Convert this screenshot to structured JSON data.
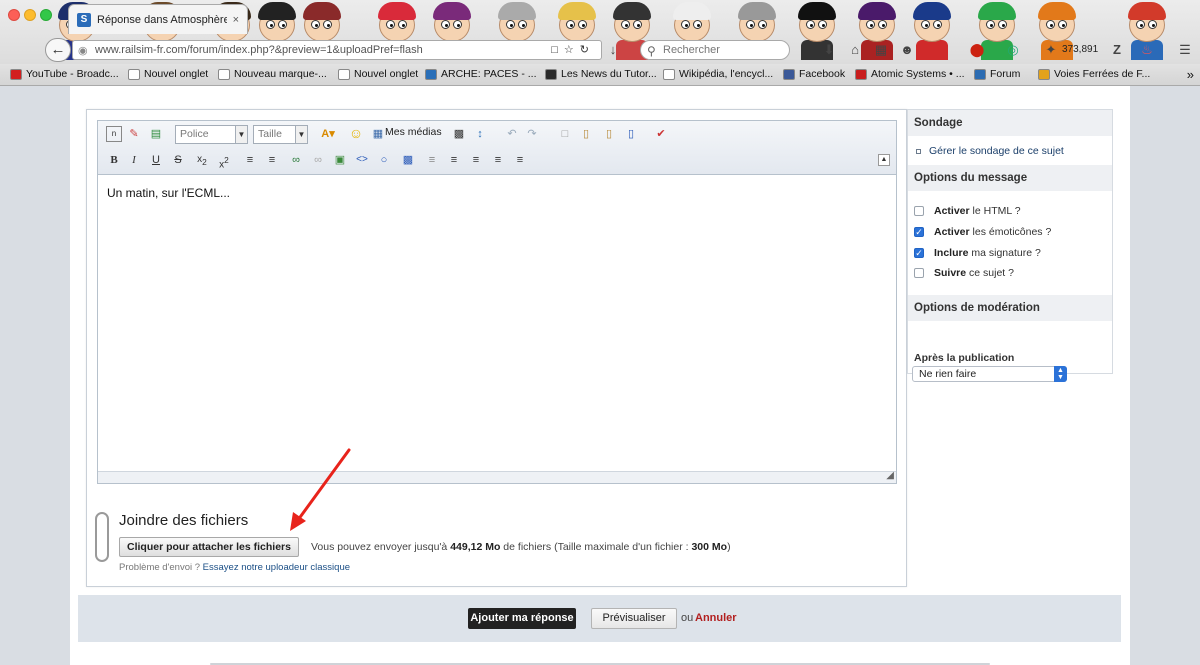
{
  "browser": {
    "tab_title": "Réponse dans Atmosphère...",
    "tab_close": "×",
    "url": "www.railsim-fr.com/forum/index.php?&preview=1&uploadPref=flash",
    "search_placeholder": "Rechercher",
    "counter": "373,891",
    "bookmarks": [
      {
        "label": "YouTube - Broadc...",
        "color": "#d21f1f"
      },
      {
        "label": "Nouvel onglet",
        "color": "#ffffff"
      },
      {
        "label": "Nouveau marque-...",
        "color": "#ffffff"
      },
      {
        "label": "Nouvel onglet",
        "color": "#ffffff"
      },
      {
        "label": "ARCHE: PACES - ...",
        "color": "#2a6fb8"
      },
      {
        "label": "Les News du Tutor...",
        "color": "#2a2a2a"
      },
      {
        "label": "Wikipédia, l'encycl...",
        "color": "#ffffff"
      },
      {
        "label": "Facebook",
        "color": "#3b5998"
      },
      {
        "label": "Atomic Systems • ...",
        "color": "#c81d1d"
      },
      {
        "label": "Forum",
        "color": "#2c6cb2"
      },
      {
        "label": "Voies Ferrées de F...",
        "color": "#e2a21b"
      }
    ]
  },
  "editor": {
    "font_select": "Police",
    "size_select": "Taille",
    "medias_label": "Mes médias",
    "content": "Un matin, sur l'ECML..."
  },
  "attach": {
    "title": "Joindre des fichiers",
    "button": "Cliquer pour attacher les fichiers",
    "info_prefix": "Vous pouvez envoyer jusqu'à ",
    "info_amount": "449,12 Mo",
    "info_mid": " de fichiers (Taille maximale d'un fichier : ",
    "info_max": "300 Mo",
    "info_suffix": ")",
    "problem_text": "Problème d'envoi ? ",
    "problem_link": "Essayez notre uploadeur classique"
  },
  "sidebar": {
    "poll_header": "Sondage",
    "poll_link": "Gérer le sondage de ce sujet",
    "options_header": "Options du message",
    "options": [
      {
        "bold": "Activer",
        "rest": " le HTML ?",
        "checked": false
      },
      {
        "bold": "Activer",
        "rest": " les émoticônes ?",
        "checked": true
      },
      {
        "bold": "Inclure",
        "rest": " ma signature ?",
        "checked": true
      },
      {
        "bold": "Suivre",
        "rest": " ce sujet ?",
        "checked": false
      }
    ],
    "moderation_header": "Options de modération",
    "after_label": "Après la publication",
    "after_value": "Ne rien faire"
  },
  "footer": {
    "submit": "Ajouter ma réponse",
    "preview": "Prévisualiser",
    "or": "ou",
    "cancel": "Annuler"
  },
  "colors": {
    "accent": "#2b72d8",
    "cancel": "#b21f1f",
    "arrow": "#e8231b"
  }
}
